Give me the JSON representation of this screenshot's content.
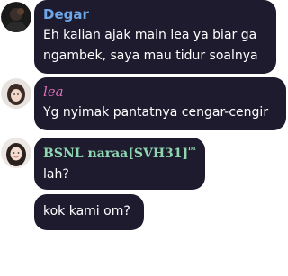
{
  "messages": [
    {
      "sender": "Degar",
      "lines": [
        "Eh kalian ajak main lea ya biar ga",
        "ngambek, saya mau tidur soalnya"
      ],
      "avatar_icon": "user-avatar-dark"
    },
    {
      "sender": "lea",
      "lines": [
        "Yg nyimak pantatnya cengar-cengir"
      ],
      "avatar_icon": "user-avatar-girl"
    },
    {
      "sender": "BSNL naraa[SVH31]",
      "sender_badge": "ᴰ¹",
      "lines": [
        "lah?"
      ],
      "avatar_icon": "user-avatar-girl"
    },
    {
      "sender": "",
      "lines": [
        "kok kami om?"
      ]
    }
  ],
  "colors": {
    "bubble_bg": "#1e1b2e",
    "degar_name": "#6ea7e8",
    "lea_name": "#d86fb8",
    "bsnl_name": "#8fd6b0"
  }
}
